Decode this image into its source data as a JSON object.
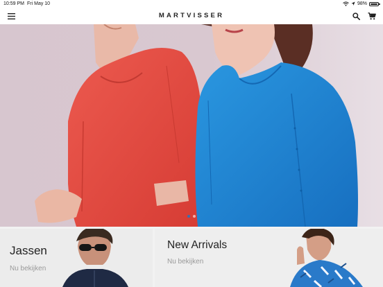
{
  "status_bar": {
    "time": "10:59 PM",
    "date": "Fri May 10",
    "battery": "98%",
    "battery_level": 0.98,
    "icons": [
      "wifi-icon",
      "location-icon",
      "battery-icon"
    ]
  },
  "navbar": {
    "brand": "MARTVISSER",
    "icons": [
      "hamburger-menu-icon",
      "search-icon",
      "cart-icon"
    ]
  },
  "hero": {
    "slide_count": 2,
    "active_slide": 1,
    "colors": {
      "left_top": "#e44b43",
      "right_top": "#1e8ad6",
      "background": "#d8c6cf"
    }
  },
  "cards": [
    {
      "title": "Jassen",
      "link": "Nu bekijken"
    },
    {
      "title": "New Arrivals",
      "link": "Nu bekijken"
    }
  ]
}
